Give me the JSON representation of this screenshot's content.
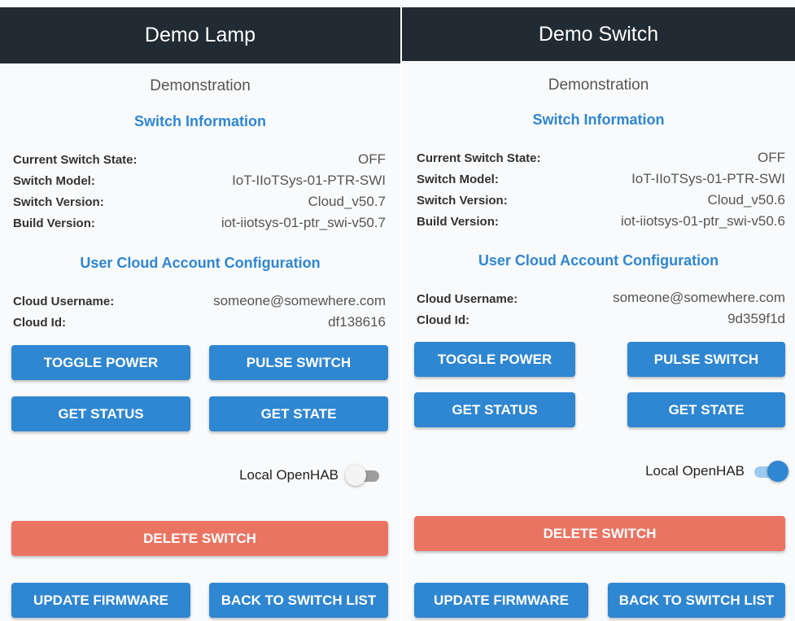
{
  "panels": [
    {
      "title": "Demo Lamp",
      "subtitle": "Demonstration",
      "switch_info_heading": "Switch Information",
      "switch_info": [
        {
          "label": "Current Switch State:",
          "value": "OFF"
        },
        {
          "label": "Switch Model:",
          "value": "IoT-IIoTSys-01-PTR-SWI"
        },
        {
          "label": "Switch Version:",
          "value": "Cloud_v50.7"
        },
        {
          "label": "Build Version:",
          "value": "iot-iiotsys-01-ptr_swi-v50.7"
        }
      ],
      "cloud_heading": "User Cloud Account Configuration",
      "cloud_info": [
        {
          "label": "Cloud Username:",
          "value": "someone@somewhere.com"
        },
        {
          "label": "Cloud Id:",
          "value": "df138616"
        }
      ],
      "buttons": {
        "toggle_power": "TOGGLE POWER",
        "pulse_switch": "PULSE SWITCH",
        "get_status": "GET STATUS",
        "get_state": "GET STATE",
        "delete_switch": "DELETE SWITCH",
        "update_firmware": "UPDATE FIRMWARE",
        "back_to_list": "BACK TO SWITCH LIST"
      },
      "local_openhab": {
        "label": "Local OpenHAB",
        "enabled": false
      }
    },
    {
      "title": "Demo Switch",
      "subtitle": "Demonstration",
      "switch_info_heading": "Switch Information",
      "switch_info": [
        {
          "label": "Current Switch State:",
          "value": "OFF"
        },
        {
          "label": "Switch Model:",
          "value": "IoT-IIoTSys-01-PTR-SWI"
        },
        {
          "label": "Switch Version:",
          "value": "Cloud_v50.6"
        },
        {
          "label": "Build Version:",
          "value": "iot-iiotsys-01-ptr_swi-v50.6"
        }
      ],
      "cloud_heading": "User Cloud Account Configuration",
      "cloud_info": [
        {
          "label": "Cloud Username:",
          "value": "someone@somewhere.com"
        },
        {
          "label": "Cloud Id:",
          "value": "9d359f1d"
        }
      ],
      "buttons": {
        "toggle_power": "TOGGLE POWER",
        "pulse_switch": "PULSE SWITCH",
        "get_status": "GET STATUS",
        "get_state": "GET STATE",
        "delete_switch": "DELETE SWITCH",
        "update_firmware": "UPDATE FIRMWARE",
        "back_to_list": "BACK TO SWITCH LIST"
      },
      "local_openhab": {
        "label": "Local OpenHAB",
        "enabled": true
      }
    }
  ],
  "colors": {
    "header_bg": "#212b33",
    "accent": "#2f86d1",
    "danger": "#ea7462"
  }
}
